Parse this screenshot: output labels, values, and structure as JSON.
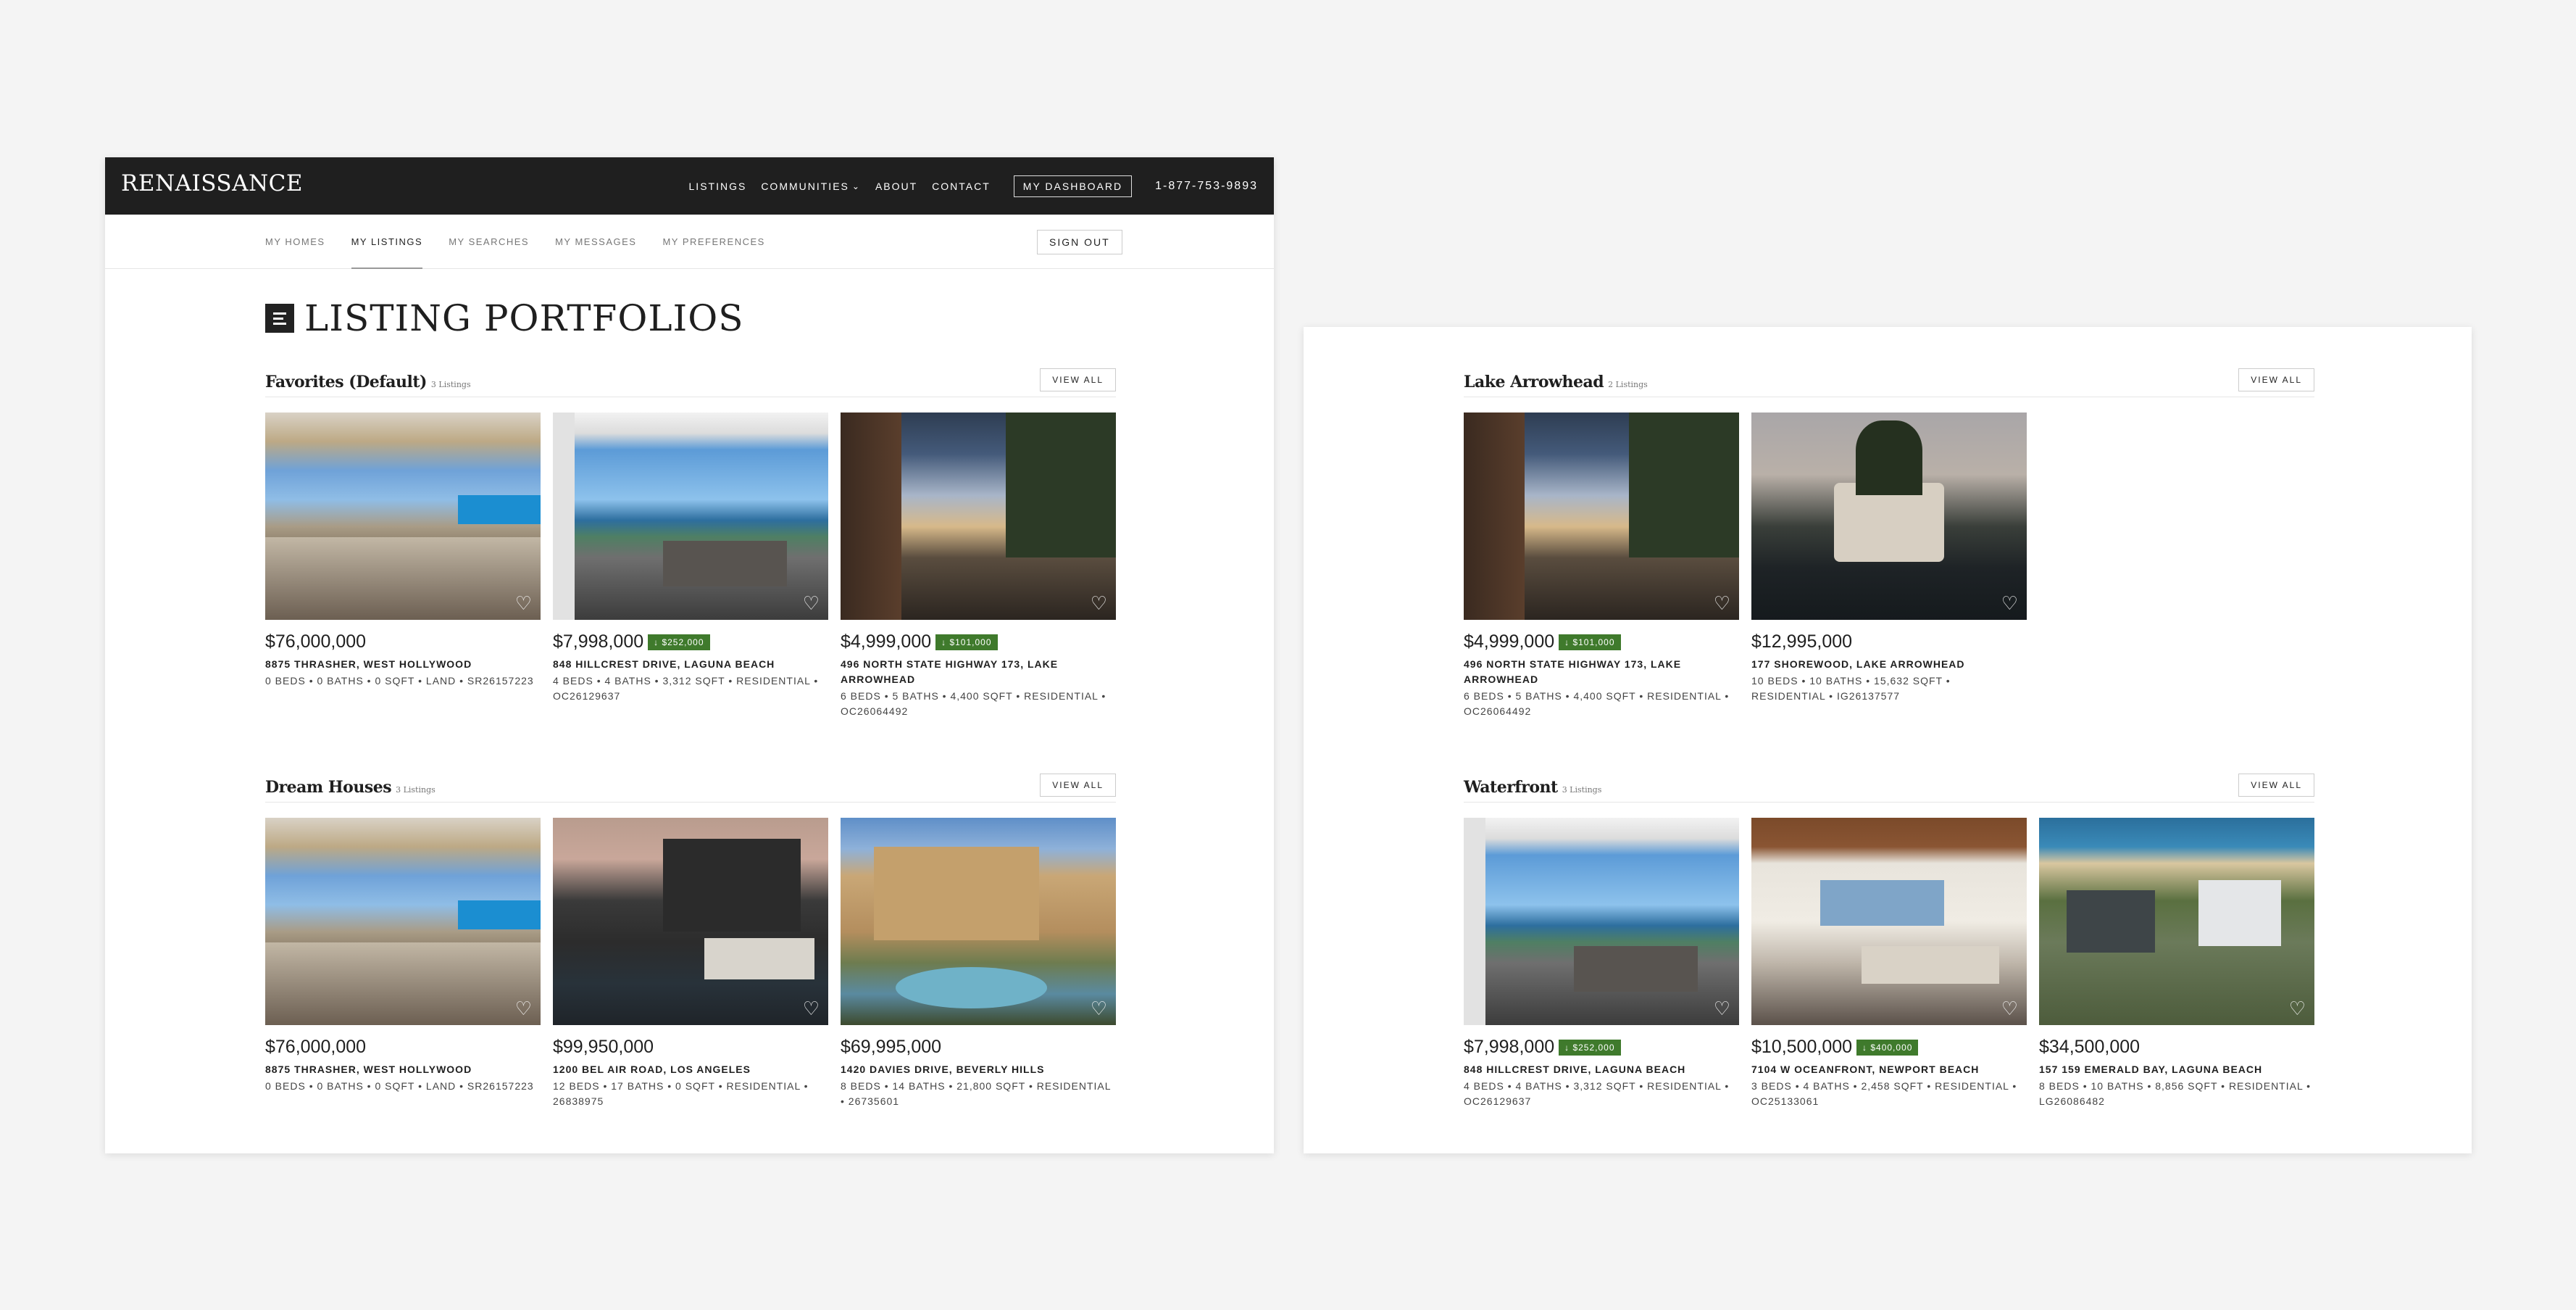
{
  "header": {
    "brand": "RENAISSANCE",
    "nav": [
      {
        "label": "LISTINGS"
      },
      {
        "label": "COMMUNITIES"
      },
      {
        "label": "ABOUT"
      },
      {
        "label": "CONTACT"
      }
    ],
    "dashboard_label": "MY DASHBOARD",
    "phone": "1-877-753-9893"
  },
  "subnav": {
    "items": [
      {
        "label": "MY HOMES"
      },
      {
        "label": "MY LISTINGS"
      },
      {
        "label": "MY SEARCHES"
      },
      {
        "label": "MY MESSAGES"
      },
      {
        "label": "MY PREFERENCES"
      }
    ],
    "active_item": "MY LISTINGS",
    "sign_out_label": "SIGN OUT"
  },
  "page_title": "LISTING PORTFOLIOS",
  "view_all_label": "VIEW ALL",
  "portfolios": [
    {
      "title": "Favorites (Default)",
      "count": "3 Listings",
      "listings": [
        {
          "price": "$76,000,000",
          "badge": "",
          "address": "8875 THRASHER, WEST HOLLYWOOD",
          "details": "0 BEDS • 0 BATHS • 0 SQFT • LAND • SR26157223"
        },
        {
          "price": "$7,998,000",
          "badge": "↓ $252,000",
          "address": "848 HILLCREST DRIVE, LAGUNA BEACH",
          "details": "4 BEDS • 4 BATHS • 3,312 SQFT • RESIDENTIAL • OC26129637"
        },
        {
          "price": "$4,999,000",
          "badge": "↓ $101,000",
          "address": "496 NORTH STATE HIGHWAY 173, LAKE ARROWHEAD",
          "details": "6 BEDS • 5 BATHS • 4,400 SQFT • RESIDENTIAL • OC26064492"
        }
      ]
    },
    {
      "title": "Dream Houses",
      "count": "3 Listings",
      "listings": [
        {
          "price": "$76,000,000",
          "badge": "",
          "address": "8875 THRASHER, WEST HOLLYWOOD",
          "details": "0 BEDS • 0 BATHS • 0 SQFT • LAND • SR26157223"
        },
        {
          "price": "$99,950,000",
          "badge": "",
          "address": "1200 BEL AIR ROAD, LOS ANGELES",
          "details": "12 BEDS • 17 BATHS • 0 SQFT • RESIDENTIAL • 26838975"
        },
        {
          "price": "$69,995,000",
          "badge": "",
          "address": "1420 DAVIES DRIVE, BEVERLY HILLS",
          "details": "8 BEDS • 14 BATHS • 21,800 SQFT • RESIDENTIAL • 26735601"
        }
      ]
    },
    {
      "title": "Lake Arrowhead",
      "count": "2 Listings",
      "listings": [
        {
          "price": "$4,999,000",
          "badge": "↓ $101,000",
          "address": "496 NORTH STATE HIGHWAY 173, LAKE ARROWHEAD",
          "details": "6 BEDS • 5 BATHS • 4,400 SQFT • RESIDENTIAL • OC26064492"
        },
        {
          "price": "$12,995,000",
          "badge": "",
          "address": "177 SHOREWOOD, LAKE ARROWHEAD",
          "details": "10 BEDS • 10 BATHS • 15,632 SQFT • RESIDENTIAL • IG26137577"
        }
      ]
    },
    {
      "title": "Waterfront",
      "count": "3 Listings",
      "listings": [
        {
          "price": "$7,998,000",
          "badge": "↓ $252,000",
          "address": "848 HILLCREST DRIVE, LAGUNA BEACH",
          "details": "4 BEDS • 4 BATHS • 3,312 SQFT • RESIDENTIAL • OC26129637"
        },
        {
          "price": "$10,500,000",
          "badge": "↓ $400,000",
          "address": "7104 W OCEANFRONT, NEWPORT BEACH",
          "details": "3 BEDS • 4 BATHS • 2,458 SQFT • RESIDENTIAL • OC25133061"
        },
        {
          "price": "$34,500,000",
          "badge": "",
          "address": "157 159 EMERALD BAY, LAGUNA BEACH",
          "details": "8 BEDS • 10 BATHS • 8,856 SQFT • RESIDENTIAL • LG26086482"
        }
      ]
    }
  ],
  "icons": {
    "favorite": "heart-icon",
    "menu": "menu-icon",
    "dropdown": "chevron-down-icon"
  },
  "colors": {
    "header_bg": "#1f1f1f",
    "price_drop_badge": "#3f7a2c",
    "page_bg": "#f4f4f4"
  }
}
